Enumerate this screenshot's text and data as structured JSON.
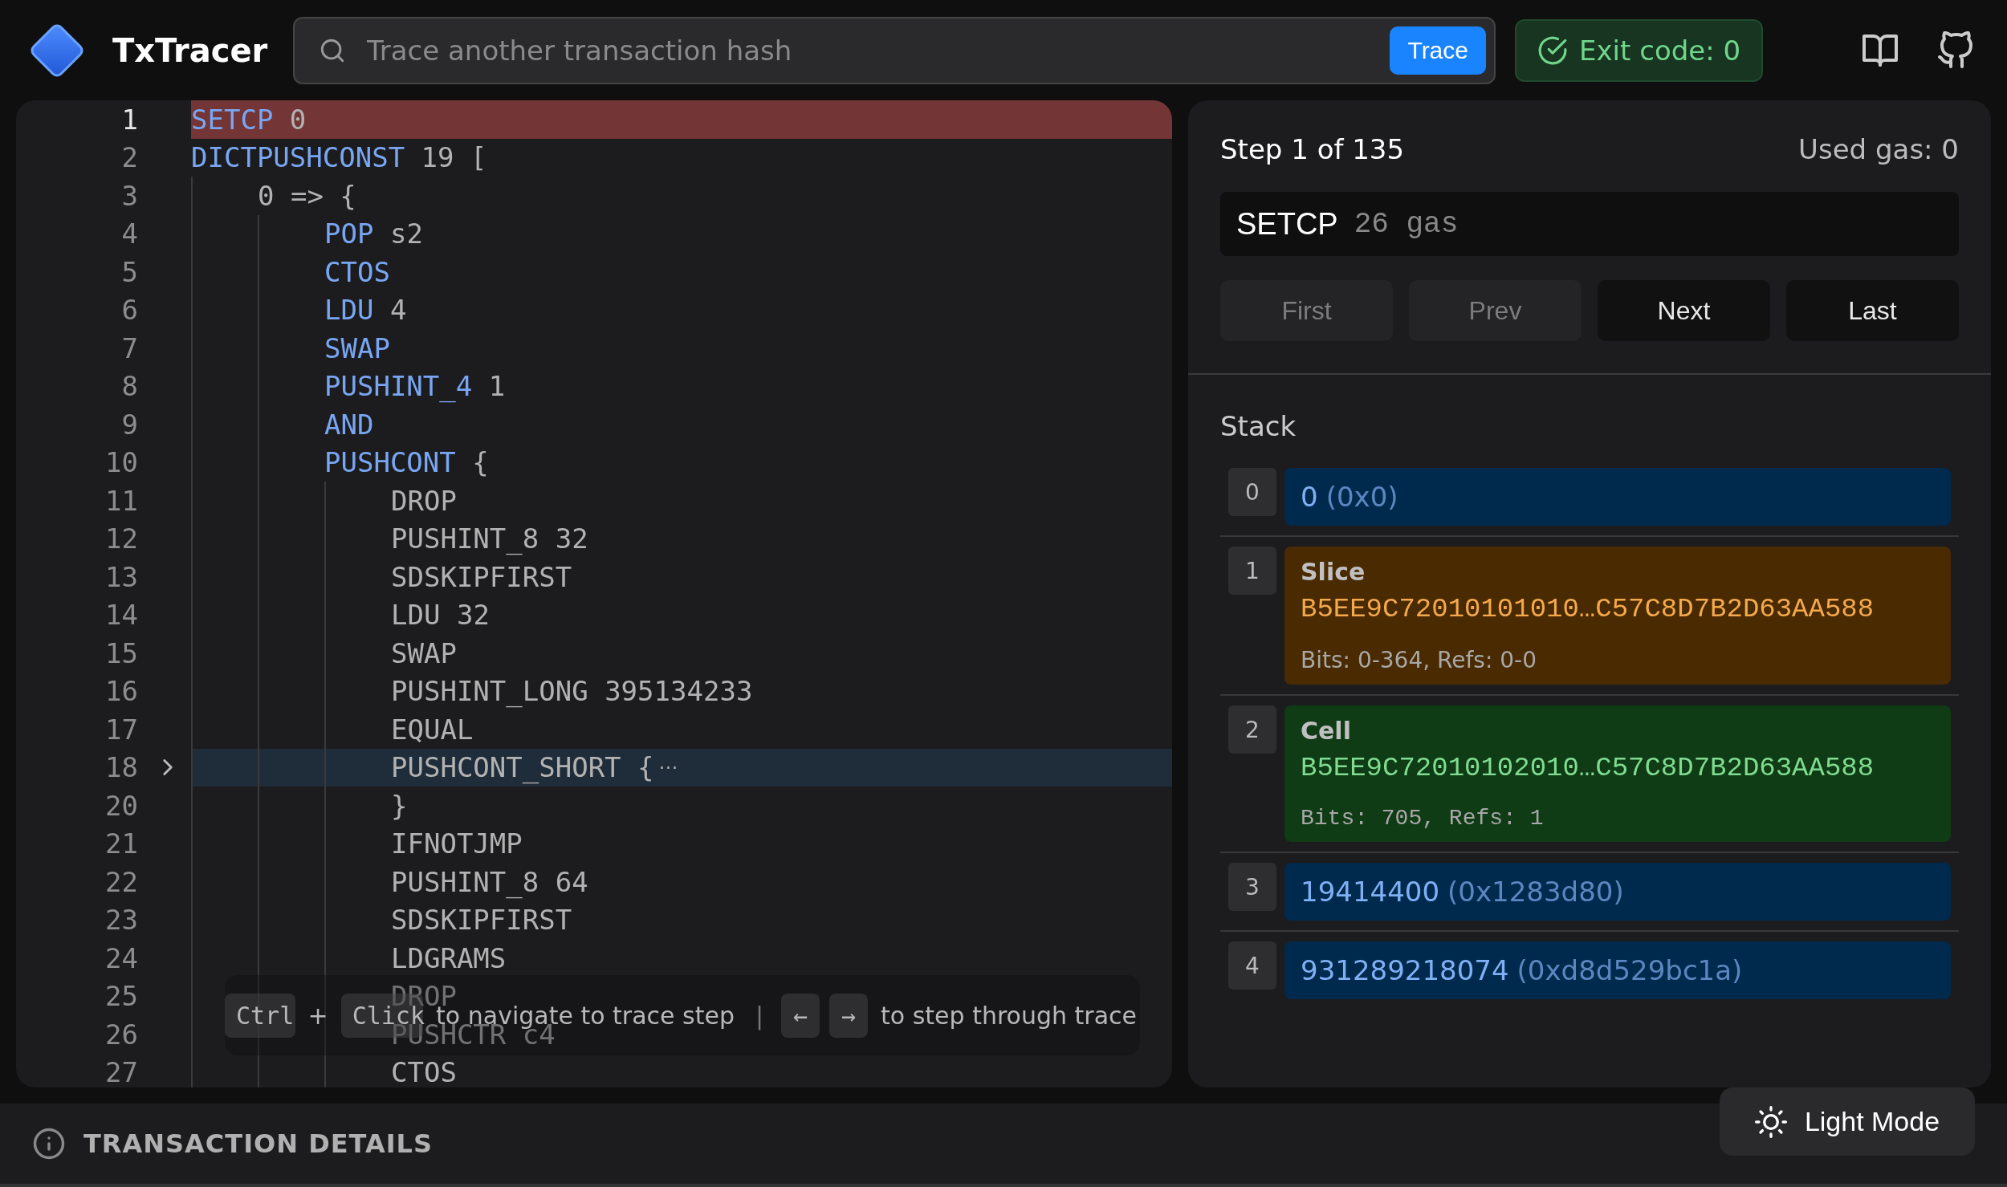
{
  "header": {
    "app_name": "TxTracer",
    "search": {
      "placeholder": "Trace another transaction hash",
      "button": "Trace"
    },
    "exit_code": "Exit code: 0"
  },
  "code": {
    "lines": [
      {
        "number": "1",
        "op": "SETCP",
        "args": "0",
        "current": true,
        "hovered": false,
        "muted": false,
        "folded": false
      },
      {
        "number": "2",
        "op": "DICTPUSHCONST",
        "args": "19 [",
        "current": false,
        "hovered": false,
        "muted": false,
        "folded": false,
        "children": [
          {
            "number": "3",
            "args": "0 => {",
            "current": false,
            "hovered": false,
            "folded": false,
            "children": [
              {
                "number": "4",
                "op": "POP",
                "args": "s2",
                "current": false,
                "hovered": false,
                "muted": false,
                "folded": false
              },
              {
                "number": "5",
                "op": "CTOS",
                "current": false,
                "hovered": false,
                "muted": false,
                "folded": false
              },
              {
                "number": "6",
                "op": "LDU",
                "args": "4",
                "current": false,
                "hovered": false,
                "muted": false,
                "folded": false
              },
              {
                "number": "7",
                "op": "SWAP",
                "current": false,
                "hovered": false,
                "muted": false,
                "folded": false
              },
              {
                "number": "8",
                "op": "PUSHINT_4",
                "args": "1",
                "current": false,
                "hovered": false,
                "muted": false,
                "folded": false
              },
              {
                "number": "9",
                "op": "AND",
                "current": false,
                "hovered": false,
                "muted": false,
                "folded": false
              },
              {
                "number": "10",
                "op": "PUSHCONT",
                "args": "{",
                "current": false,
                "hovered": false,
                "muted": false,
                "folded": false,
                "children": [
                  {
                    "number": "11",
                    "op": "DROP",
                    "current": false,
                    "hovered": false,
                    "muted": true,
                    "folded": false
                  },
                  {
                    "number": "12",
                    "op": "PUSHINT_8",
                    "args": "32",
                    "current": false,
                    "hovered": false,
                    "muted": true,
                    "folded": false
                  },
                  {
                    "number": "13",
                    "op": "SDSKIPFIRST",
                    "current": false,
                    "hovered": false,
                    "muted": true,
                    "folded": false
                  },
                  {
                    "number": "14",
                    "op": "LDU",
                    "args": "32",
                    "current": false,
                    "hovered": false,
                    "muted": true,
                    "folded": false
                  },
                  {
                    "number": "15",
                    "op": "SWAP",
                    "current": false,
                    "hovered": false,
                    "muted": true,
                    "folded": false
                  },
                  {
                    "number": "16",
                    "op": "PUSHINT_LONG",
                    "args": "395134233",
                    "current": false,
                    "hovered": false,
                    "muted": true,
                    "folded": false
                  },
                  {
                    "number": "17",
                    "op": "EQUAL",
                    "current": false,
                    "hovered": false,
                    "muted": true,
                    "folded": false
                  },
                  {
                    "number": "18",
                    "op": "PUSHCONT_SHORT",
                    "args": "{",
                    "fold_marker": "⋯",
                    "current": false,
                    "hovered": true,
                    "muted": true,
                    "folded": true
                  },
                  {
                    "number": "20",
                    "args": "}",
                    "current": false,
                    "hovered": false,
                    "folded": false
                  },
                  {
                    "number": "21",
                    "op": "IFNOTJMP",
                    "current": false,
                    "hovered": false,
                    "muted": true,
                    "folded": false
                  },
                  {
                    "number": "22",
                    "op": "PUSHINT_8",
                    "args": "64",
                    "current": false,
                    "hovered": false,
                    "muted": true,
                    "folded": false
                  },
                  {
                    "number": "23",
                    "op": "SDSKIPFIRST",
                    "current": false,
                    "hovered": false,
                    "muted": true,
                    "folded": false
                  },
                  {
                    "number": "24",
                    "op": "LDGRAMS",
                    "current": false,
                    "hovered": false,
                    "muted": true,
                    "folded": false
                  },
                  {
                    "number": "25",
                    "op": "DROP",
                    "current": false,
                    "hovered": false,
                    "muted": true,
                    "folded": false
                  },
                  {
                    "number": "26",
                    "op": "PUSHCTR",
                    "args": "c4",
                    "current": false,
                    "hovered": false,
                    "muted": true,
                    "folded": false
                  },
                  {
                    "number": "27",
                    "op": "CTOS",
                    "current": false,
                    "hovered": false,
                    "muted": true,
                    "folded": false
                  }
                ]
              }
            ]
          }
        ]
      }
    ],
    "hint": [
      {
        "kind": "key",
        "text": "Ctrl"
      },
      {
        "kind": "text",
        "text": "+"
      },
      {
        "kind": "key",
        "text": "Click"
      },
      {
        "kind": "text",
        "text": "to navigate to trace step"
      },
      {
        "kind": "separator",
        "text": "|"
      },
      {
        "kind": "key",
        "text": "←"
      },
      {
        "kind": "key",
        "text": "→"
      },
      {
        "kind": "text",
        "text": "to step through trace"
      }
    ]
  },
  "step": {
    "title": "Step 1 of 135",
    "used_gas": "Used gas: 0",
    "instruction": "SETCP",
    "gas": "26 gas",
    "buttons": [
      {
        "label": "First",
        "disabled": true
      },
      {
        "label": "Prev",
        "disabled": true
      },
      {
        "label": "Next",
        "disabled": false
      },
      {
        "label": "Last",
        "disabled": false
      }
    ]
  },
  "stack": {
    "title": "Stack",
    "items": [
      {
        "index": "0",
        "kind": "int",
        "value": "0",
        "hex": "(0x0)"
      },
      {
        "index": "1",
        "kind": "slice",
        "label": "Slice",
        "data": "B5EE9C72010101010…C57C8D7B2D63AA588",
        "info": "Bits: 0-364, Refs: 0-0"
      },
      {
        "index": "2",
        "kind": "cell",
        "label": "Cell",
        "data": "B5EE9C72010102010…C57C8D7B2D63AA588",
        "info": "Bits: 705, Refs: 1"
      },
      {
        "index": "3",
        "kind": "int",
        "value": "19414400",
        "hex": "(0x1283d80)"
      },
      {
        "index": "4",
        "kind": "int",
        "value": "931289218074",
        "hex": "(0xd8d529bc1a)"
      }
    ]
  },
  "footer": {
    "title": "TRANSACTION DETAILS"
  },
  "theme_button": "Light Mode"
}
